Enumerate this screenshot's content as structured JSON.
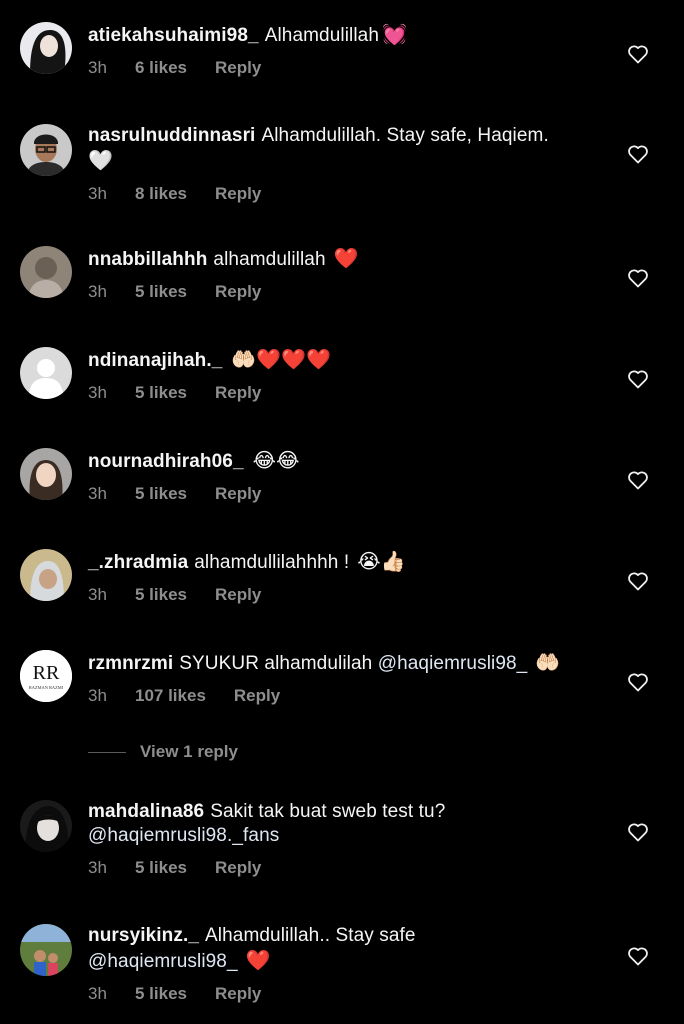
{
  "comments": [
    {
      "username": "atiekahsuhaimi98_",
      "text": "Alhamdulillah",
      "emoji": "💓",
      "time": "3h",
      "likes": "6 likes",
      "reply": "Reply"
    },
    {
      "username": "nasrulnuddinnasri",
      "text": "Alhamdulillah. Stay safe, Haqiem.",
      "emoji": "🤍",
      "time": "3h",
      "likes": "8 likes",
      "reply": "Reply"
    },
    {
      "username": "nnabbillahhh",
      "text": "alhamdulillah",
      "emoji": "❤️",
      "time": "3h",
      "likes": "5 likes",
      "reply": "Reply"
    },
    {
      "username": "ndinanajihah._",
      "text": "",
      "emoji": "🤲🏻❤️❤️❤️",
      "time": "3h",
      "likes": "5 likes",
      "reply": "Reply"
    },
    {
      "username": "nournadhirah06_",
      "text": "",
      "emoji": "😂😂",
      "time": "3h",
      "likes": "5 likes",
      "reply": "Reply"
    },
    {
      "username": "_.zhradmia",
      "text": "alhamdullilahhhh !",
      "emoji": "😭👍🏻",
      "time": "3h",
      "likes": "5 likes",
      "reply": "Reply"
    },
    {
      "username": "rzmnrzmi",
      "text": "SYUKUR alhamdulilah",
      "mention": "@haqiemrusli98_",
      "emoji": "🤲🏻",
      "time": "3h",
      "likes": "107 likes",
      "reply": "Reply"
    },
    {
      "username": "mahdalina86",
      "text": "Sakit tak buat sweb test tu?",
      "mention": "@haqiemrusli98._fans",
      "time": "3h",
      "likes": "5 likes",
      "reply": "Reply"
    },
    {
      "username": "nursyikinz._",
      "text": "Alhamdulillah.. Stay safe",
      "mention": "@haqiemrusli98_",
      "emoji": "❤️",
      "time": "3h",
      "likes": "5 likes",
      "reply": "Reply"
    }
  ],
  "view_replies_label": "View 1 reply",
  "avatar_logo_text": "RAZMAN RAZMI",
  "colors": {
    "background": "#000000",
    "text": "#ffffff",
    "meta": "#8e8e8e"
  }
}
